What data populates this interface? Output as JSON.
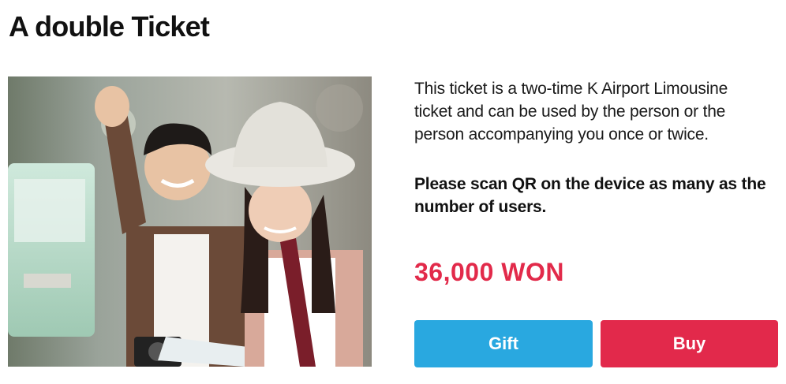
{
  "page": {
    "title": "A double Ticket"
  },
  "product": {
    "image_label": "photo-couple-travelers",
    "description": "This ticket is a two-time K Airport Limousine ticket and can be used by the person or the person accompanying you once or twice.",
    "notice": "Please scan QR on the device as many as the number of users.",
    "price": "36,000 WON"
  },
  "actions": {
    "gift_label": "Gift",
    "buy_label": "Buy"
  },
  "colors": {
    "price": "#e22a4a",
    "gift_button": "#29a8e0",
    "buy_button": "#e2294b",
    "text": "#111111"
  }
}
